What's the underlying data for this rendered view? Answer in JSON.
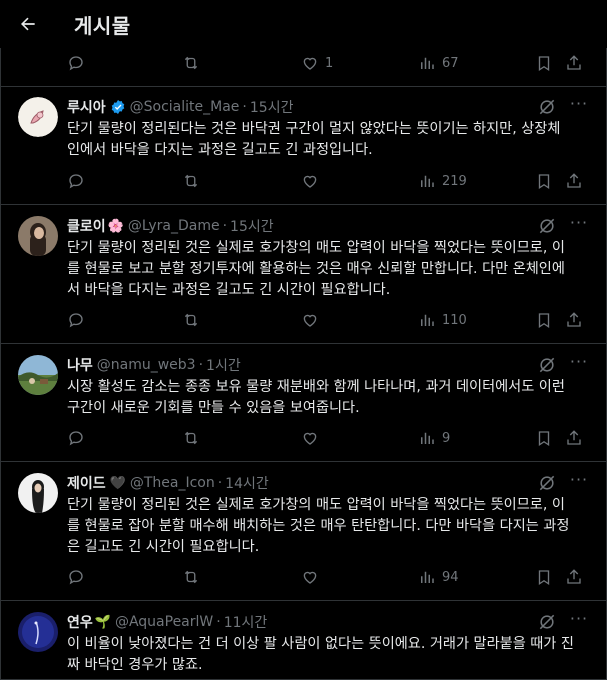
{
  "header": {
    "title": "게시물"
  },
  "top_actions": {
    "likes": "1",
    "views": "67"
  },
  "posts": [
    {
      "name": "루시아",
      "verified": true,
      "handle": "@Socialite_Mae",
      "time": "15시간",
      "text": "단기 물량이 정리된다는 것은 바닥권 구간이 멀지 않았다는 뜻이기는 하지만, 상장체\n인에서 바닥을 다지는 과정은 길고도 긴 과정입니다.",
      "views": "219"
    },
    {
      "name": "클로이",
      "emoji": "🌸",
      "handle": "@Lyra_Dame",
      "time": "15시간",
      "text": "단기 물량이 정리된 것은 실제로 호가창의 매도 압력이 바닥을 찍었다는 뜻이므로, 이\n를 현물로 보고 분할 정기투자에 활용하는 것은 매우 신뢰할 만합니다. 다만 온체인에\n서 바닥을 다지는 과정은 길고도 긴 시간이 필요합니다.",
      "views": "110"
    },
    {
      "name": "나무",
      "handle": "@namu_web3",
      "time": "1시간",
      "text": "시장 활성도 감소는 종종 보유 물량 재분배와 함께 나타나며, 과거 데이터에서도 이런\n구간이 새로운 기회를 만들 수 있음을 보여줍니다.",
      "views": "9"
    },
    {
      "name": "제이드",
      "emoji": "🖤",
      "handle": "@Thea_Icon",
      "time": "14시간",
      "text": "단기 물량이 정리된 것은 실제로 호가창의 매도 압력이 바닥을 찍었다는 뜻이므로, 이\n를 현물로 잡아 분할 매수해 배치하는 것은 매우 탄탄합니다. 다만 바닥을 다지는 과정\n은 길고도 긴 시간이 필요합니다.",
      "views": "94"
    },
    {
      "name": "연우",
      "emoji": "🌱",
      "handle": "@AquaPearlW",
      "time": "11시간",
      "text": "이 비율이 낮아졌다는 건 더 이상 팔 사람이 없다는 뜻이에요. 거래가 말라붙을 때가 진\n짜 바닥인 경우가 많죠.",
      "views": ""
    }
  ],
  "icons": [
    "back-arrow-icon",
    "reply-icon",
    "repost-icon",
    "like-icon",
    "views-icon",
    "bookmark-icon",
    "share-icon",
    "grok-icon",
    "more-icon",
    "verified-icon"
  ],
  "colors": {
    "background": "#000000",
    "text": "#e7e9ea",
    "muted": "#71767b",
    "verified": "#1d9bf0",
    "separator": "#2f3336"
  }
}
